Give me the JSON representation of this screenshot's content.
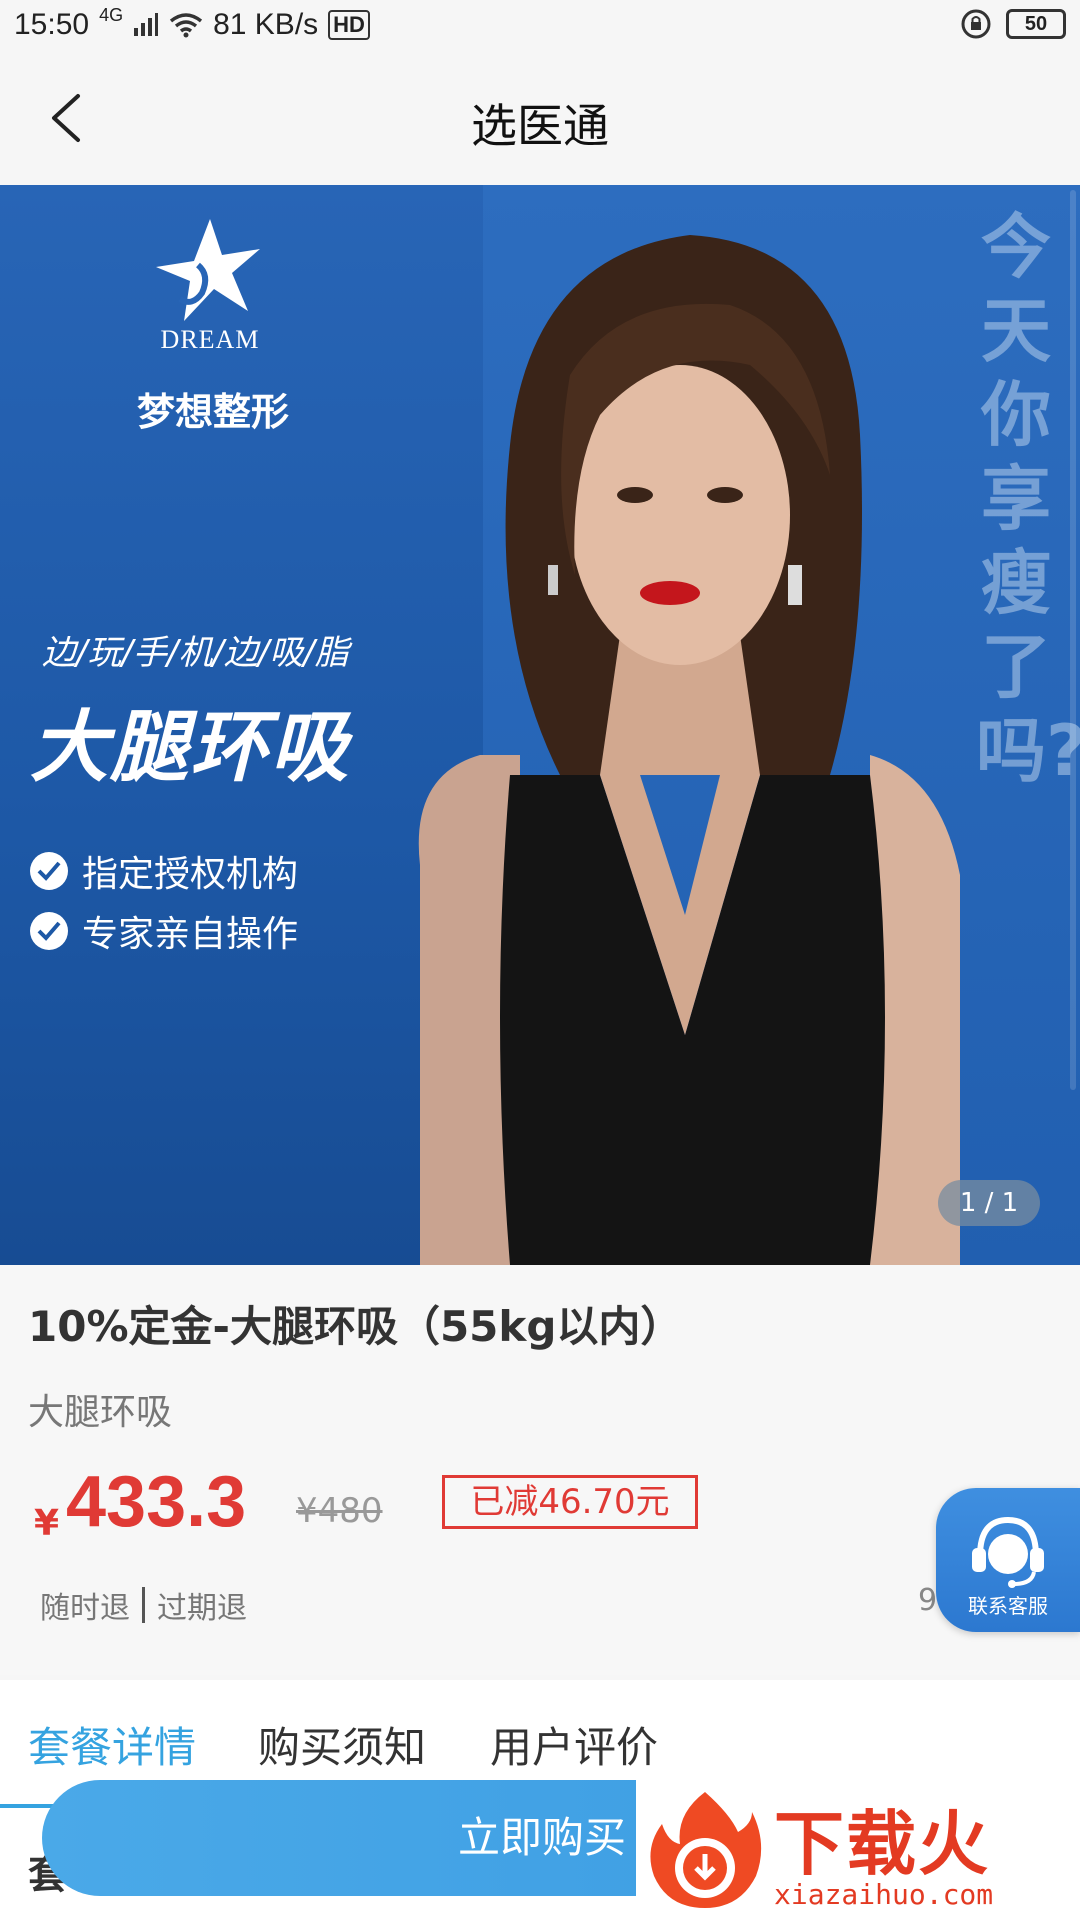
{
  "status_bar": {
    "time": "15:50",
    "network": "4G",
    "speed": "81 KB/s",
    "hd": "HD",
    "battery": "50"
  },
  "nav": {
    "title": "选医通"
  },
  "banner": {
    "brand_en": "DREAM",
    "brand_cn": "梦想整形",
    "slogan": "边/玩/手/机/边/吸/脂",
    "headline": "大腿环吸",
    "features": [
      "指定授权机构",
      "专家亲自操作"
    ],
    "vertical_text": "今天你享瘦了吗?",
    "pager": "1 / 1",
    "colors": {
      "background": "#1f5bab"
    }
  },
  "product": {
    "title": "10%定金-大腿环吸（55kg以内）",
    "subtitle": "大腿环吸",
    "currency": "¥",
    "price": "433.3",
    "original_price": "¥480",
    "discount": "已减46.70元",
    "refund_any_time": "随时退",
    "refund_expired": "过期退",
    "sold_count_partial": "9",
    "colors": {
      "price": "#e03a35"
    }
  },
  "customer_service": {
    "label": "联系客服"
  },
  "tabs": {
    "items": [
      {
        "label": "套餐详情",
        "active": true
      },
      {
        "label": "购买须知",
        "active": false
      },
      {
        "label": "用户评价",
        "active": false
      }
    ],
    "section_peek": "套",
    "colors": {
      "active": "#35a3e0"
    }
  },
  "buy_bar": {
    "label": "立即购买"
  },
  "watermark": {
    "text": "下载火",
    "url": "xiazaihuo.com"
  }
}
